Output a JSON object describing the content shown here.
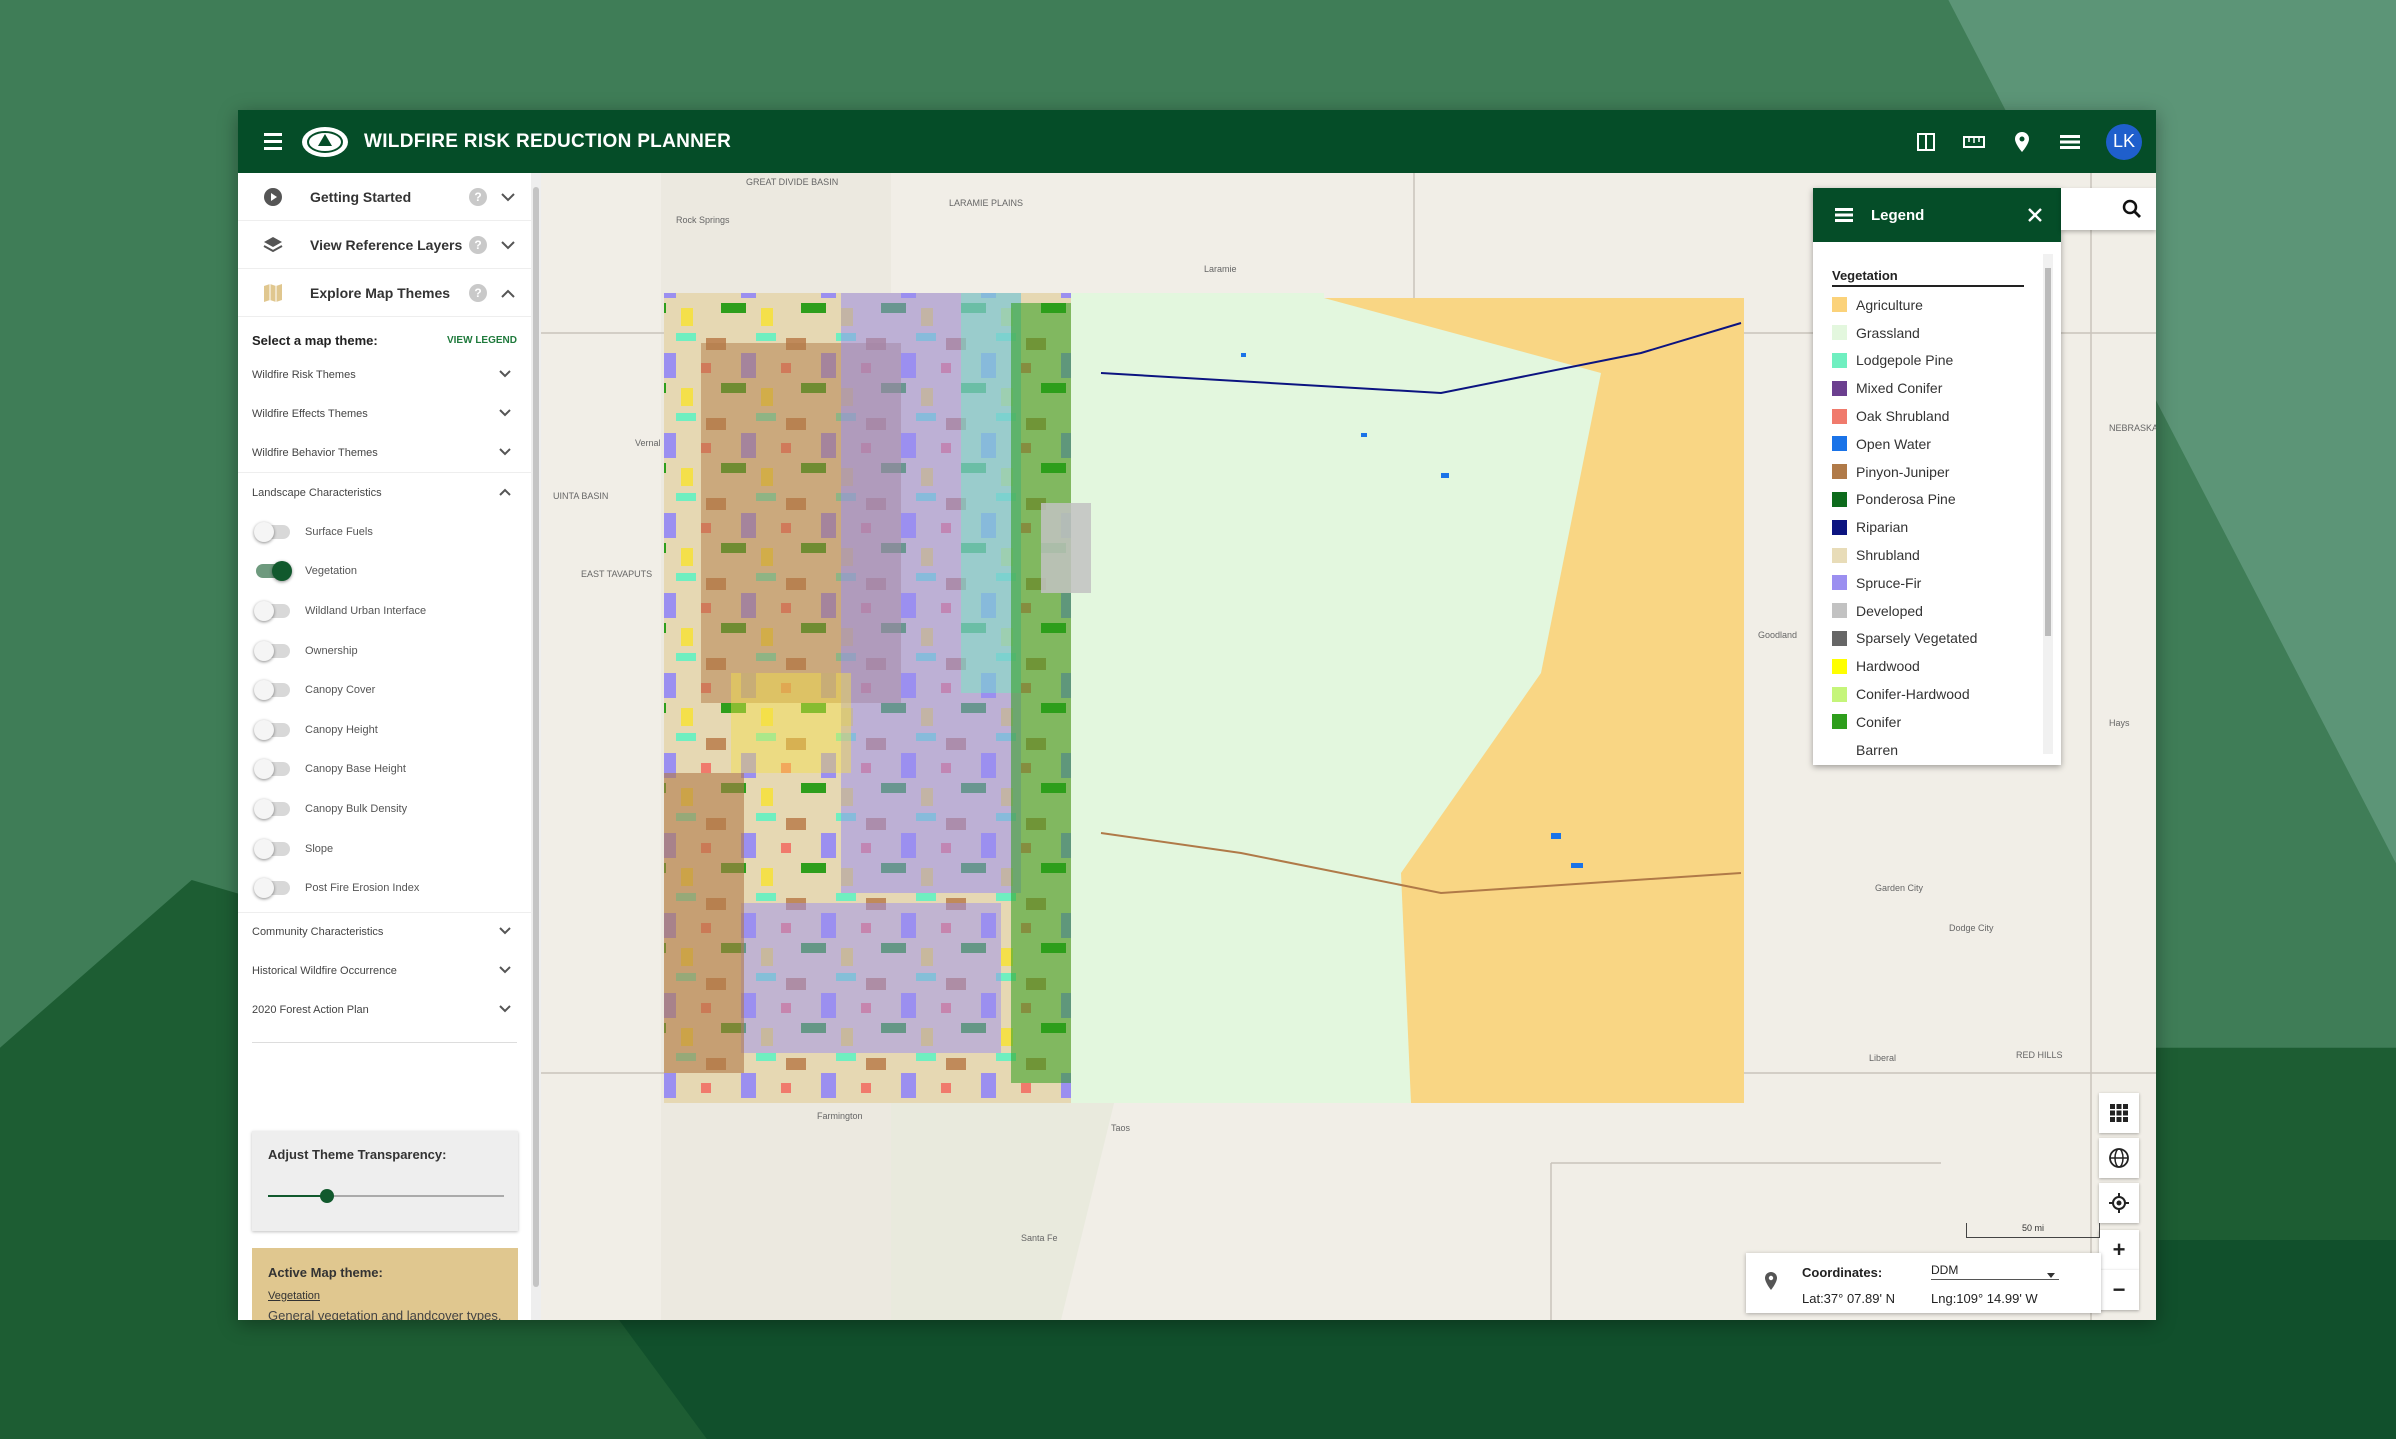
{
  "colors": {
    "brand_green": "#054d28",
    "accent_green": "#1f7a3c",
    "active_theme_bg": "#e0c78f",
    "avatar_blue": "#1f5fcc"
  },
  "app": {
    "title": "WILDFIRE RISK REDUCTION PLANNER",
    "user_initials": "LK",
    "toolbar_icons": [
      "split-view-icon",
      "ruler-icon",
      "map-pin-icon",
      "layers-list-icon"
    ]
  },
  "sidebar": {
    "sections": [
      {
        "label": "Getting Started",
        "icon": "play-circle-icon",
        "expanded": false
      },
      {
        "label": "View Reference Layers",
        "icon": "layers-icon",
        "expanded": false
      },
      {
        "label": "Explore Map Themes",
        "icon": "map-icon",
        "expanded": true
      }
    ],
    "select_theme_label": "Select a map theme:",
    "view_legend_label": "VIEW LEGEND",
    "theme_groups": [
      {
        "label": "Wildfire Risk Themes"
      },
      {
        "label": "Wildfire Effects Themes"
      },
      {
        "label": "Wildfire Behavior Themes"
      },
      {
        "label": "Landscape Characteristics"
      }
    ],
    "landscape_layers": [
      {
        "label": "Surface Fuels",
        "on": false
      },
      {
        "label": "Vegetation",
        "on": true
      },
      {
        "label": "Wildland Urban Interface",
        "on": false
      },
      {
        "label": "Ownership",
        "on": false
      },
      {
        "label": "Canopy Cover",
        "on": false
      },
      {
        "label": "Canopy Height",
        "on": false
      },
      {
        "label": "Canopy Base Height",
        "on": false
      },
      {
        "label": "Canopy Bulk Density",
        "on": false
      },
      {
        "label": "Slope",
        "on": false
      },
      {
        "label": "Post Fire Erosion Index",
        "on": false
      }
    ],
    "more_groups": [
      {
        "label": "Community Characteristics"
      },
      {
        "label": "Historical Wildfire Occurrence"
      },
      {
        "label": "2020 Forest Action Plan"
      }
    ],
    "transparency_label": "Adjust Theme Transparency:",
    "transparency_value": 0.25,
    "active_theme_heading": "Active Map theme:",
    "active_theme_name": "Vegetation",
    "active_theme_desc": "General vegetation and landcover types."
  },
  "legend": {
    "title": "Legend",
    "section": "Vegetation",
    "items": [
      {
        "label": "Agriculture",
        "color": "#fbd27a"
      },
      {
        "label": "Grassland",
        "color": "#e3f7de"
      },
      {
        "label": "Lodgepole Pine",
        "color": "#6fefc0"
      },
      {
        "label": "Mixed Conifer",
        "color": "#6b3f8f"
      },
      {
        "label": "Oak Shrubland",
        "color": "#f07a6c"
      },
      {
        "label": "Open Water",
        "color": "#1a73e8"
      },
      {
        "label": "Pinyon-Juniper",
        "color": "#b07a48"
      },
      {
        "label": "Ponderosa Pine",
        "color": "#0d6b1c"
      },
      {
        "label": "Riparian",
        "color": "#0c1480"
      },
      {
        "label": "Shrubland",
        "color": "#e8dcb8"
      },
      {
        "label": "Spruce-Fir",
        "color": "#9b8ff0"
      },
      {
        "label": "Developed",
        "color": "#c2c2c2"
      },
      {
        "label": "Sparsely Vegetated",
        "color": "#666666"
      },
      {
        "label": "Hardwood",
        "color": "#ffff00"
      },
      {
        "label": "Conifer-Hardwood",
        "color": "#c5f57a"
      },
      {
        "label": "Conifer",
        "color": "#2e9e1c"
      },
      {
        "label": "Barren",
        "color": "#ffffff"
      }
    ]
  },
  "map": {
    "labels": [
      {
        "text": "GREAT DIVIDE BASIN"
      },
      {
        "text": "LARAMIE PLAINS"
      },
      {
        "text": "Rock Springs"
      },
      {
        "text": "Laramie"
      },
      {
        "text": "Vernal"
      },
      {
        "text": "UINTA BASIN"
      },
      {
        "text": "EAST TAVAPUTS"
      },
      {
        "text": "Goodland"
      },
      {
        "text": "Garden City"
      },
      {
        "text": "Dodge City"
      },
      {
        "text": "Liberal"
      },
      {
        "text": "RED HILLS"
      },
      {
        "text": "Farmington"
      },
      {
        "text": "Taos"
      },
      {
        "text": "Santa Fe"
      },
      {
        "text": "Hays"
      },
      {
        "text": "NEBRASKA"
      }
    ],
    "scale_label": "50 mi",
    "zoom_in": "+",
    "zoom_out": "−",
    "tool_icons": [
      "basemap-grid-icon",
      "globe-icon",
      "locate-icon"
    ]
  },
  "coordinates": {
    "label": "Coordinates:",
    "format": "DDM",
    "lat": "Lat:37° 07.89' N",
    "lng": "Lng:109° 14.99' W"
  }
}
